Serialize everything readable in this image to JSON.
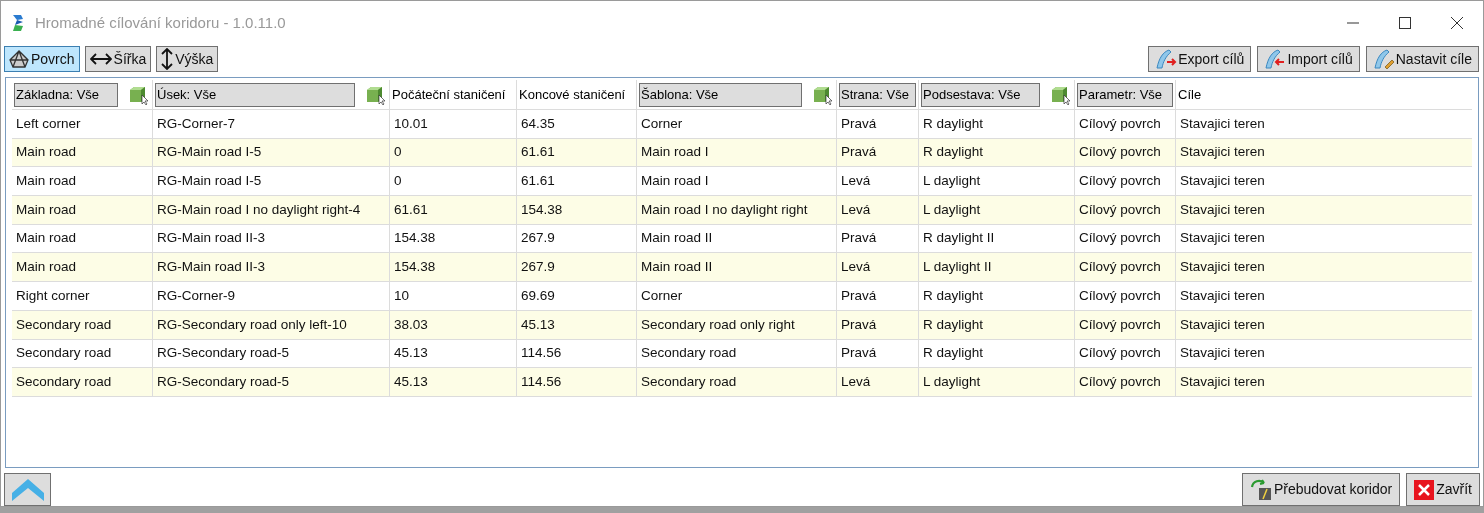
{
  "window": {
    "title": "Hromadné cílování koridoru - 1.0.11.0"
  },
  "view_buttons": [
    {
      "label": "Povrch",
      "kind": "surface",
      "selected": true
    },
    {
      "label": "Šířka",
      "kind": "width",
      "selected": false
    },
    {
      "label": "Výška",
      "kind": "height",
      "selected": false
    }
  ],
  "action_buttons": [
    {
      "label": "Export cílů",
      "kind": "export"
    },
    {
      "label": "Import cílů",
      "kind": "import"
    },
    {
      "label": "Nastavit cíle",
      "kind": "set"
    }
  ],
  "table": {
    "columns": [
      {
        "label": "Základna: Vše",
        "kind": "filter",
        "pick_icon": true
      },
      {
        "label": "Úsek: Vše",
        "kind": "filter",
        "pick_icon": true
      },
      {
        "label": "Počáteční staničení",
        "kind": "plain",
        "pick_icon": false
      },
      {
        "label": "Koncové staničení",
        "kind": "plain",
        "pick_icon": false
      },
      {
        "label": "Šablona: Vše",
        "kind": "filter",
        "pick_icon": true
      },
      {
        "label": "Strana: Vše",
        "kind": "filter",
        "pick_icon": false
      },
      {
        "label": "Podsestava: Vše",
        "kind": "filter",
        "pick_icon": true
      },
      {
        "label": "Parametr: Vše",
        "kind": "filter",
        "pick_icon": false
      },
      {
        "label": "Cíle",
        "kind": "plain",
        "pick_icon": false
      }
    ],
    "rows": [
      [
        "Left corner",
        "RG-Corner-7",
        "10.01",
        "64.35",
        "Corner",
        "Pravá",
        "R daylight",
        "Cílový povrch",
        "Stavajici teren"
      ],
      [
        "Main road",
        "RG-Main road I-5",
        "0",
        "61.61",
        "Main road I",
        "Pravá",
        "R daylight",
        "Cílový povrch",
        "Stavajici teren"
      ],
      [
        "Main road",
        "RG-Main road I-5",
        "0",
        "61.61",
        "Main road I",
        "Levá",
        "L daylight",
        "Cílový povrch",
        "Stavajici teren"
      ],
      [
        "Main road",
        "RG-Main road I no daylight right-4",
        "61.61",
        "154.38",
        "Main road I no daylight right",
        "Levá",
        "L daylight",
        "Cílový povrch",
        "Stavajici teren"
      ],
      [
        "Main road",
        "RG-Main road II-3",
        "154.38",
        "267.9",
        "Main road II",
        "Pravá",
        "R daylight II",
        "Cílový povrch",
        "Stavajici teren"
      ],
      [
        "Main road",
        "RG-Main road II-3",
        "154.38",
        "267.9",
        "Main road II",
        "Levá",
        "L daylight II",
        "Cílový povrch",
        "Stavajici teren"
      ],
      [
        "Right corner",
        "RG-Corner-9",
        "10",
        "69.69",
        "Corner",
        "Pravá",
        "R daylight",
        "Cílový povrch",
        "Stavajici teren"
      ],
      [
        "Secondary road",
        "RG-Secondary road only left-10",
        "38.03",
        "45.13",
        "Secondary road only right",
        "Pravá",
        "R daylight",
        "Cílový povrch",
        "Stavajici teren"
      ],
      [
        "Secondary road",
        "RG-Secondary road-5",
        "45.13",
        "114.56",
        "Secondary road",
        "Pravá",
        "R daylight",
        "Cílový povrch",
        "Stavajici teren"
      ],
      [
        "Secondary road",
        "RG-Secondary road-5",
        "45.13",
        "114.56",
        "Secondary road",
        "Levá",
        "L daylight",
        "Cílový povrch",
        "Stavajici teren"
      ]
    ]
  },
  "footer_buttons": [
    {
      "label": "Přebudovat koridor",
      "kind": "rebuild"
    },
    {
      "label": "Zavřít",
      "kind": "close"
    }
  ]
}
